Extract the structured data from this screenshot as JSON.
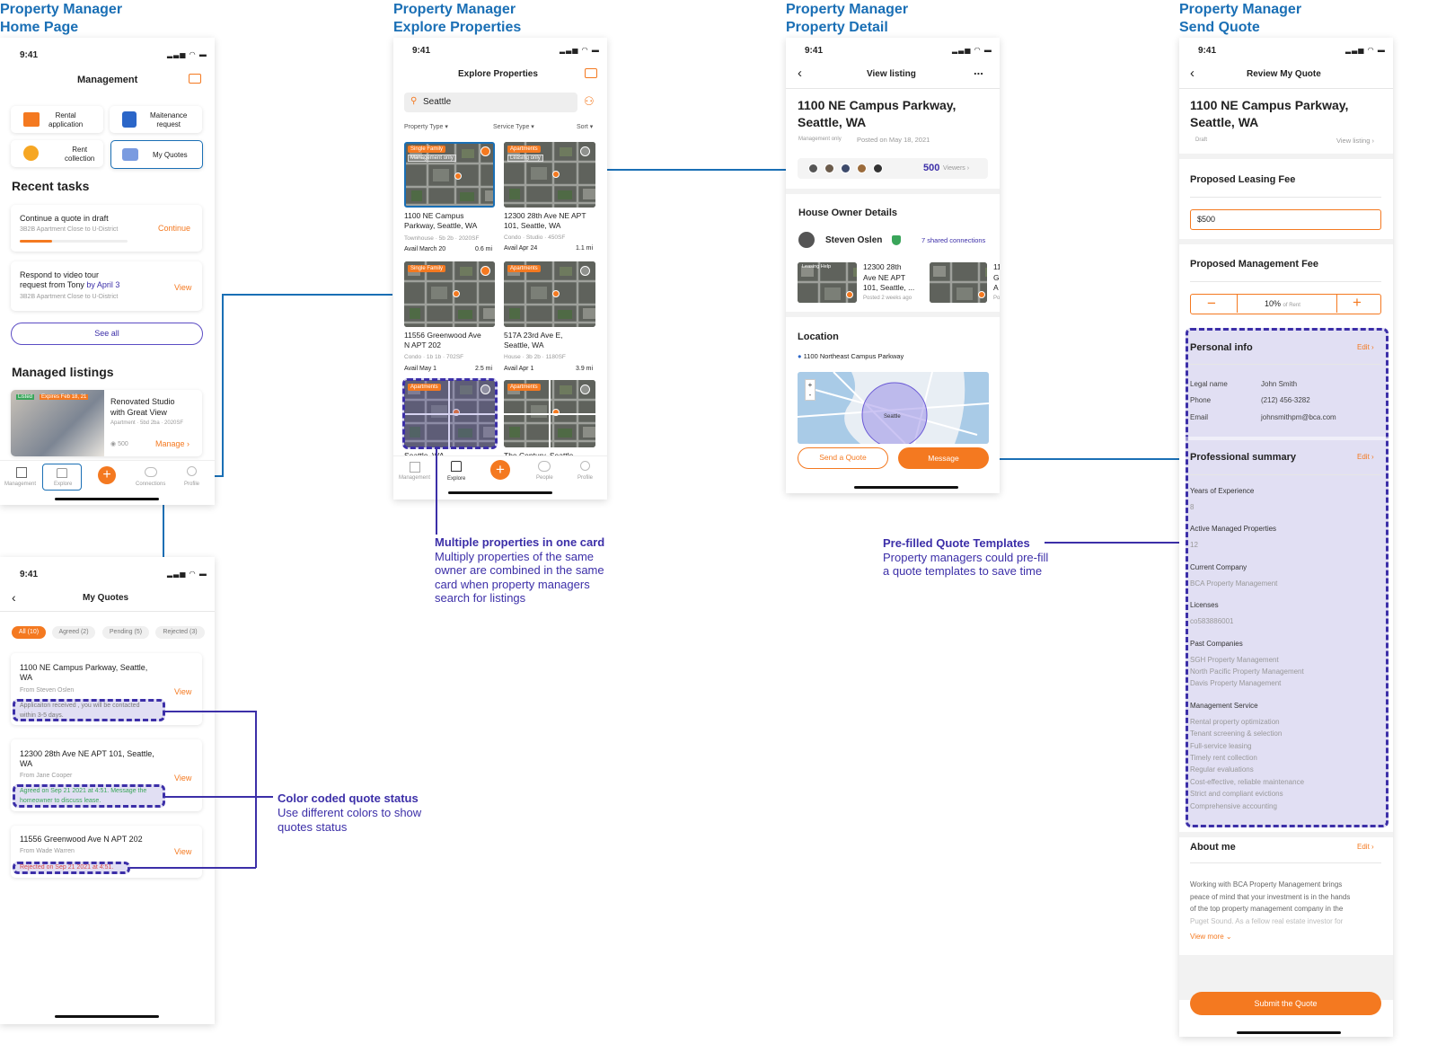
{
  "titles": {
    "home": [
      "Property Manager",
      "Home Page"
    ],
    "explore": [
      "Property Manager",
      "Explore Properties"
    ],
    "detail": [
      "Property Manager",
      "Property Detail"
    ],
    "quote": [
      "Property Manager",
      "Send Quote"
    ]
  },
  "status_time": "9:41",
  "home": {
    "header": "Management",
    "tiles": [
      "Rental application",
      "Maitenance request",
      "Rent collection",
      "My Quotes"
    ],
    "tiles_lines": [
      [
        "Rental",
        "application"
      ],
      [
        "Maitenance",
        "request"
      ],
      [
        "Rent",
        "collection"
      ],
      [
        "My Quotes"
      ]
    ],
    "recent_title": "Recent tasks",
    "task1": {
      "title": "Continue a quote in draft",
      "sub": "3B2B Apartment Close to U-District",
      "action": "Continue",
      "progress": 0.3
    },
    "task2": {
      "line1": "Respond to video tour",
      "line2a": "request from Tony ",
      "line2b": "by April 3",
      "sub": "3B2B Apartment Close to U-District",
      "action": "View"
    },
    "see_all": "See all",
    "managed_title": "Managed listings",
    "listing": {
      "badge1": "Listed",
      "badge2": "Expires Feb 18, 21",
      "title1": "Renovated Studio",
      "title2": "with Great View",
      "meta": "Apartment · 5bd 2ba · 2020SF",
      "views": "500",
      "manage": "Manage"
    },
    "nav": [
      "Management",
      "Explore",
      "Connections",
      "Profile"
    ]
  },
  "myquotes": {
    "header": "My Quotes",
    "filters": [
      "All (10)",
      "Agreed (2)",
      "Pending (5)",
      "Rejected (3)"
    ],
    "quotes": [
      {
        "addr1": "1100 NE Campus Parkway, Seattle,",
        "addr2": "WA",
        "from": "From Steven Oslen",
        "action": "View",
        "status1": "Applicaiton received , you will be contacted",
        "status2": "within 3-5 days."
      },
      {
        "addr1": "12300 28th Ave NE APT 101, Seattle,",
        "addr2": "WA",
        "from": "From Jane Cooper",
        "action": "View",
        "status1": "Agreed on Sep 21 2021 at 4:51. Message the",
        "status2": "homeowner to discuss lease."
      },
      {
        "addr1": "11556 Greenwood Ave N APT 202",
        "addr2": "",
        "from": "From Wade Warren",
        "action": "View",
        "status1": "Rejected on Sep 21 2021 at 4:51.",
        "status2": ""
      }
    ]
  },
  "explore": {
    "header": "Explore Properties",
    "search_value": "Seattle",
    "filters": [
      "Property Type",
      "Service Type",
      "Sort"
    ],
    "cards": [
      {
        "tag": "Single Family",
        "tag2": "Management only",
        "addr1": "1100 NE Campus",
        "addr2": "Parkway, Seattle, WA",
        "meta": "Townhouse · 5b 2b · 2020SF",
        "avail": "Avail March 20",
        "dist": "0.6 mi"
      },
      {
        "tag": "Apartments",
        "tag2": "Leasing only",
        "addr1": "12300 28th Ave NE APT",
        "addr2": "101, Seattle, WA",
        "meta": "Condo · Studio · 450SF",
        "avail": "Avail Apr 24",
        "dist": "1.1 mi"
      },
      {
        "tag": "Single Family",
        "tag2": "",
        "addr1": "11556 Greenwood Ave",
        "addr2": "N APT 202",
        "meta": "Condo · 1b 1b · 702SF",
        "avail": "Avail May 1",
        "dist": "2.5 mi"
      },
      {
        "tag": "Apartments",
        "tag2": "",
        "addr1": "517A 23rd Ave E,",
        "addr2": "Seattle, WA",
        "meta": "House · 3b 2b · 1180SF",
        "avail": "Avail Apr 1",
        "dist": "3.9 mi"
      },
      {
        "tag": "Apartments",
        "tag2": "",
        "addr1": "Seattle, WA",
        "addr2": "",
        "meta": "",
        "avail": "",
        "dist": ""
      },
      {
        "tag": "Apartments",
        "tag2": "",
        "addr1": "The Century, Seattle",
        "addr2": "",
        "meta": "",
        "avail": "",
        "dist": ""
      }
    ],
    "nav": [
      "Management",
      "Explore",
      "People",
      "Profile"
    ]
  },
  "detail": {
    "header": "View listing",
    "more": "...",
    "addr1": "1100 NE Campus Parkway,",
    "addr2": "Seattle, WA",
    "meta1": "Management only",
    "meta2": "Posted on May 18, 2021",
    "viewers_num": "500",
    "viewers_label": "Viewers",
    "owner_title": "House Owner Details",
    "owner_name": "Steven Oslen",
    "connections": "7 shared connections",
    "other": {
      "tag": "Leasing Help",
      "a1": "12300 28th",
      "a2": "Ave NE APT",
      "a3": "101, Seattle, ...",
      "posted": "Posted 2 weeks ago"
    },
    "other2": [
      "11",
      "G",
      "A",
      "Po"
    ],
    "location_title": "Location",
    "location_addr": "1100 Northeast Campus Parkway",
    "map_label": "Seattle",
    "zoom": [
      "+",
      "-"
    ],
    "send_quote": "Send a Quote",
    "message": "Message"
  },
  "quote": {
    "header": "Review My Quote",
    "addr1": "1100 NE Campus Parkway,",
    "addr2": "Seattle, WA",
    "status": "Draft",
    "view_listing": "View listing",
    "leasing_title": "Proposed Leasing Fee",
    "leasing_value": "$500",
    "mgmt_title": "Proposed Management Fee",
    "mgmt_value": "10%",
    "mgmt_unit": "of Rent",
    "personal_title": "Personal info",
    "edit": "Edit",
    "personal": [
      {
        "label": "Legal name",
        "value": "John Smith"
      },
      {
        "label": "Phone",
        "value": "(212) 456-3282"
      },
      {
        "label": "Email",
        "value": "johnsmithpm@bca.com"
      }
    ],
    "prof_title": "Professional summary",
    "prof": [
      {
        "label": "Years of Experience",
        "values": [
          "8"
        ]
      },
      {
        "label": "Active Managed Properties",
        "values": [
          "12"
        ]
      },
      {
        "label": "Current Company",
        "values": [
          "BCA Property Management"
        ]
      },
      {
        "label": "Licenses",
        "values": [
          "co583886001"
        ]
      },
      {
        "label": "Past Companies",
        "values": [
          "SGH Property Management",
          "North Pacific Property Management",
          "Davis Property Management"
        ]
      },
      {
        "label": "Management Service",
        "values": [
          "Rental property optimization",
          "Tenant screening & selection",
          "Full-service leasing",
          "Timely rent collection",
          "Regular evaluations",
          "Cost-effective, reliable maintenance",
          "Strict and compliant evictions",
          "Comprehensive accounting"
        ]
      }
    ],
    "about_title": "About me",
    "about_lines": [
      "Working with BCA Property Management brings",
      "peace of mind that your investment is in the hands",
      "of the top property management company in the",
      "Puget Sound. As a fellow real estate investor for"
    ],
    "view_more": "View more",
    "submit": "Submit the Quote"
  },
  "annotations": {
    "multi": {
      "title": "Multiple properties in one card",
      "lines": [
        "Multiply properties of the same",
        "owner are combined in the same",
        "card when property managers",
        "search for listings"
      ]
    },
    "prefill": {
      "title": "Pre-filled Quote Templates",
      "lines": [
        "Property managers could pre-fill",
        "a quote templates to save time"
      ]
    },
    "color": {
      "title": "Color coded quote status",
      "lines": [
        "Use different colors to show",
        "quotes status"
      ]
    }
  },
  "colors": {
    "accent": "#f47920",
    "title_blue": "#1a6fb5",
    "annotation_purple": "#3c2fa8",
    "agreed_green": "#3aa55a",
    "rejected_red": "#d84a4a"
  }
}
